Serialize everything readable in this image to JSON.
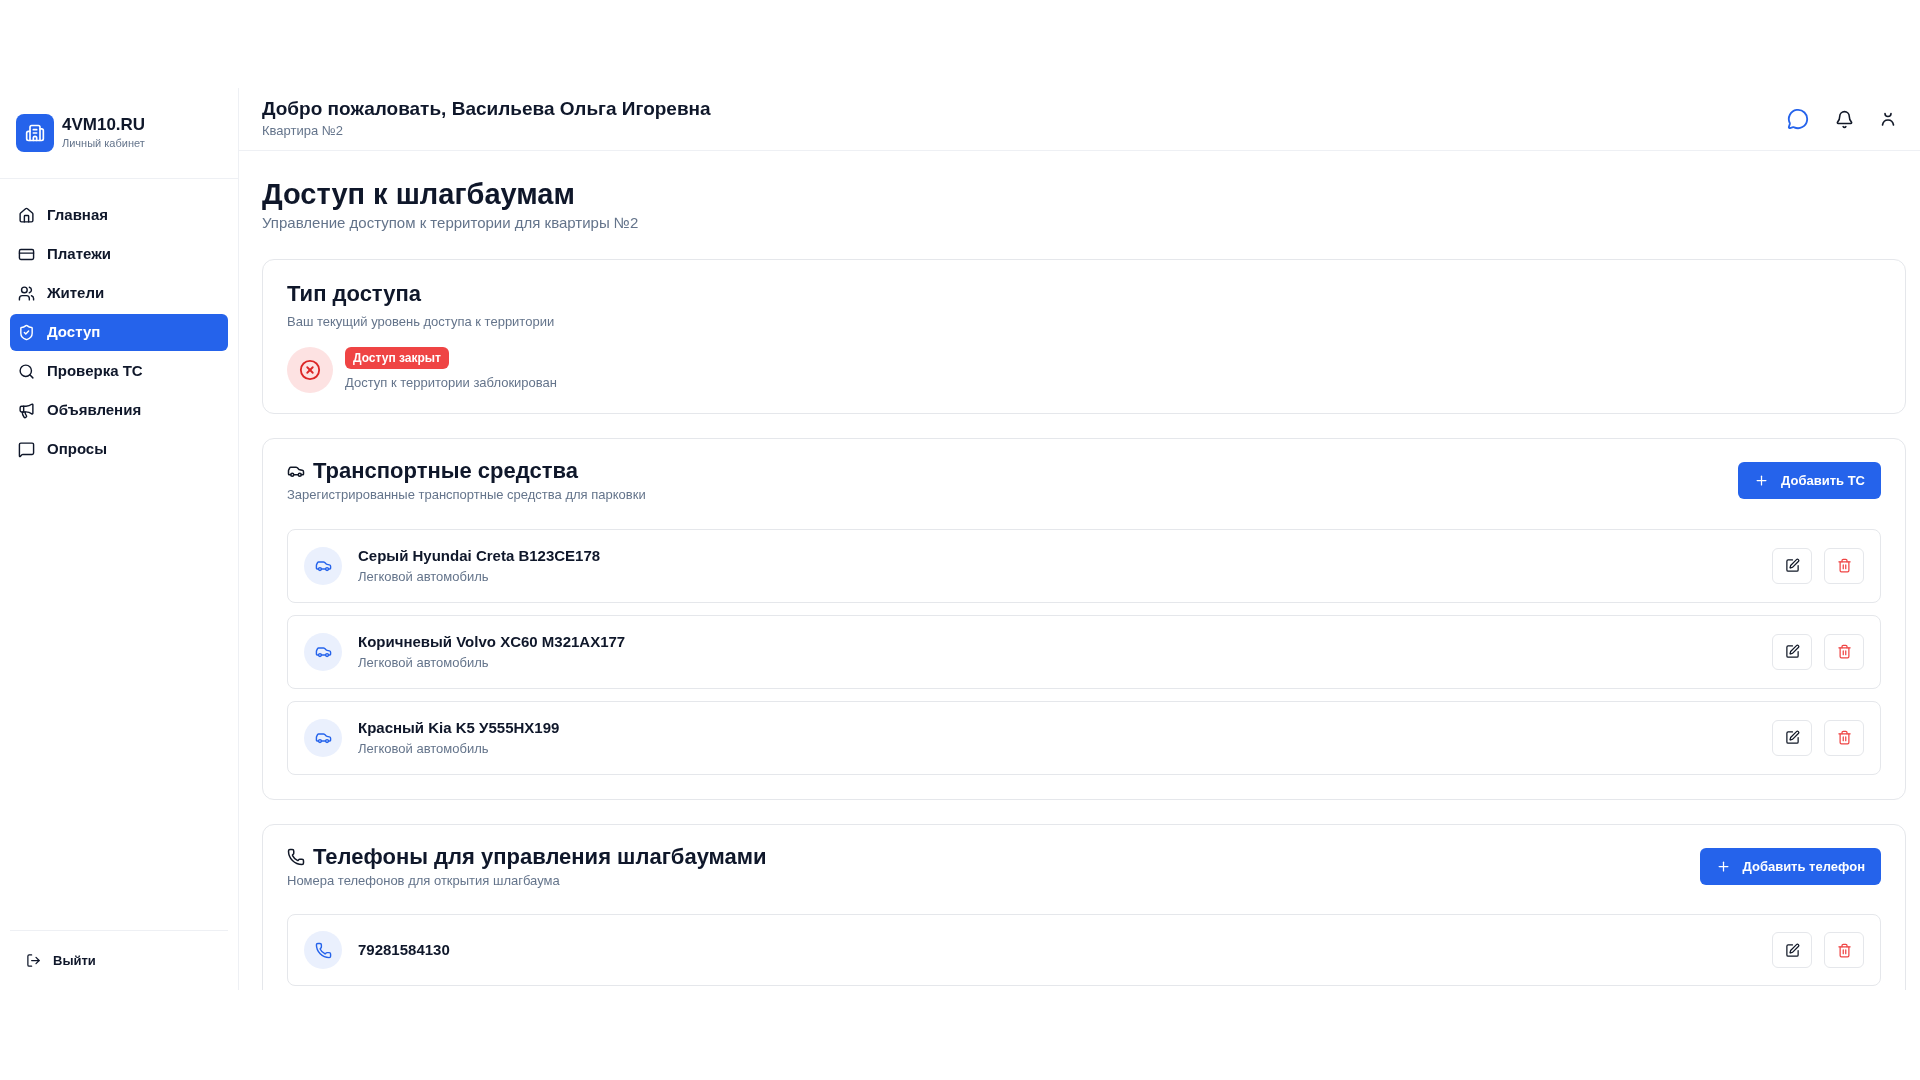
{
  "brand": {
    "name": "4VM10.RU",
    "subtitle": "Личный кабинет"
  },
  "nav": [
    {
      "label": "Главная",
      "selected": false
    },
    {
      "label": "Платежи",
      "selected": false
    },
    {
      "label": "Жители",
      "selected": false
    },
    {
      "label": "Доступ",
      "selected": true
    },
    {
      "label": "Проверка ТС",
      "selected": false
    },
    {
      "label": "Объявления",
      "selected": false
    },
    {
      "label": "Опросы",
      "selected": false
    }
  ],
  "logout": "Выйти",
  "header": {
    "title": "Добро пожаловать, Васильева Ольга Игоревна",
    "subtitle": "Квартира №2"
  },
  "page": {
    "title": "Доступ к шлагбаумам",
    "subtitle": "Управление доступом к территории для квартиры №2"
  },
  "access": {
    "title": "Тип доступа",
    "subtitle": "Ваш текущий уровень доступа к территории",
    "kind": "closed",
    "badge": "Доступ закрыт",
    "description": "Доступ к территории заблокирован"
  },
  "vehicles": {
    "title": "Транспортные средства",
    "subtitle": "Зарегистрированные транспортные средства для парковки",
    "button": "Добавить ТС",
    "items": [
      {
        "name": "Серый Hyundai Creta В123СЕ178",
        "type": "Легковой автомобиль"
      },
      {
        "name": "Коричневый Volvo XC60 М321АХ177",
        "type": "Легковой автомобиль"
      },
      {
        "name": "Красный Kia K5 У555НХ199",
        "type": "Легковой автомобиль"
      }
    ]
  },
  "phones": {
    "title": "Телефоны для управления шлагбаумами",
    "subtitle": "Номера телефонов для открытия шлагбаума",
    "button": "Добавить телефон",
    "items": [
      {
        "number": "79281584130"
      }
    ]
  }
}
